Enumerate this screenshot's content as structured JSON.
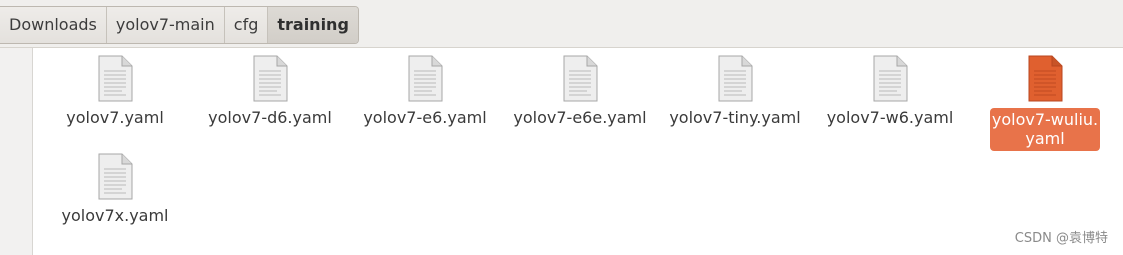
{
  "breadcrumb": [
    "Downloads",
    "yolov7-main",
    "cfg",
    "training"
  ],
  "files": [
    {
      "name": "yolov7.yaml",
      "selected": false
    },
    {
      "name": "yolov7-d6.yaml",
      "selected": false
    },
    {
      "name": "yolov7-e6.yaml",
      "selected": false
    },
    {
      "name": "yolov7-e6e.yaml",
      "selected": false
    },
    {
      "name": "yolov7-tiny.yaml",
      "selected": false
    },
    {
      "name": "yolov7-w6.yaml",
      "selected": false
    },
    {
      "name": "yolov7-wuliu.\nyaml",
      "selected": true
    },
    {
      "name": "yolov7x.yaml",
      "selected": false
    }
  ],
  "colors": {
    "selection": "#e8734a",
    "doc_icon": "#e6e6e6",
    "selected_icon": "#e0602f"
  },
  "watermark": "CSDN @袁博特"
}
